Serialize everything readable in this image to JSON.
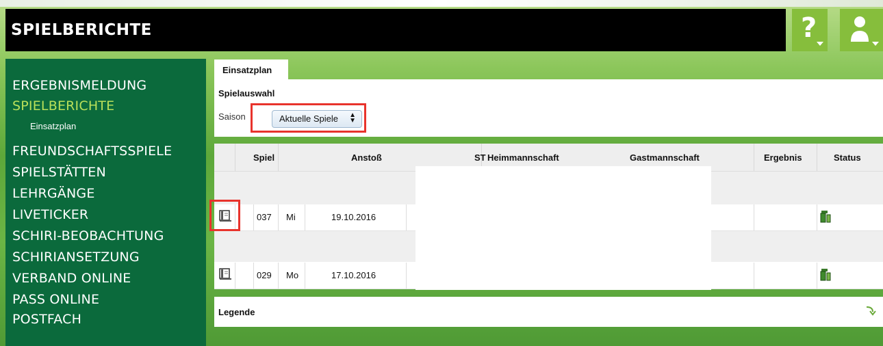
{
  "header": {
    "title": "SPIELBERICHTE",
    "help_icon": "question-mark-icon",
    "user_icon": "user-icon"
  },
  "sidebar": {
    "items": [
      {
        "label": "ERGEBNISMELDUNG",
        "active": false
      },
      {
        "label": "SPIELBERICHTE",
        "active": true
      },
      {
        "label": "FREUNDSCHAFTSSPIELE",
        "active": false
      },
      {
        "label": "SPIELSTÄTTEN",
        "active": false
      },
      {
        "label": "LEHRGÄNGE",
        "active": false
      },
      {
        "label": "LIVETICKER",
        "active": false
      },
      {
        "label": "SCHIRI-BEOBACHTUNG",
        "active": false
      },
      {
        "label": "SCHIRIANSETZUNG",
        "active": false
      },
      {
        "label": "VERBAND ONLINE",
        "active": false
      },
      {
        "label": "PASS ONLINE",
        "active": false
      },
      {
        "label": "POSTFACH",
        "active": false
      }
    ],
    "sub_item": "Einsatzplan"
  },
  "tab": {
    "label": "Einsatzplan"
  },
  "selection": {
    "title": "Spielauswahl",
    "saison_label": "Saison",
    "saison_value": "Aktuelle Spiele"
  },
  "table": {
    "headers": {
      "spiel": "Spiel",
      "anstoss": "Anstoß",
      "st": "ST",
      "heim": "Heimmannschaft",
      "gast": "Gastmannschaft",
      "ergebnis": "Ergebnis",
      "status": "Status"
    },
    "rows": [
      {
        "spiel": "037",
        "tag": "Mi",
        "datum": "19.10.2016"
      },
      {
        "spiel": "029",
        "tag": "Mo",
        "datum": "17.10.2016"
      }
    ]
  },
  "legend": {
    "label": "Legende"
  },
  "colors": {
    "sidebar_bg": "#0b6a3c",
    "active_nav": "#b9e05a",
    "header_btn": "#86be3c",
    "highlight": "#e8332c"
  }
}
